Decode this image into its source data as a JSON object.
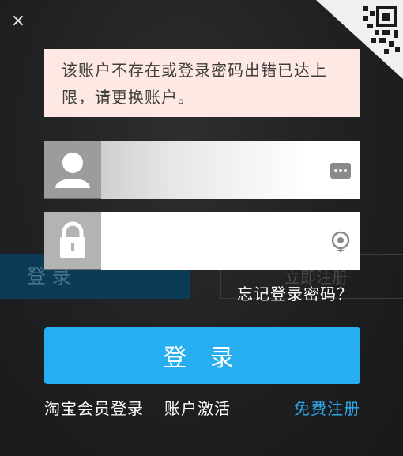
{
  "window": {
    "close_glyph": "×"
  },
  "error": {
    "message": "该账户不存在或登录密码出错已达上限，请更换账户。"
  },
  "username_field": {
    "value": "",
    "icon": "user-icon",
    "right_icon": "dots-keyboard-icon"
  },
  "password_field": {
    "value": "",
    "icon": "lock-icon",
    "right_icon": "eye-toggle-icon"
  },
  "background": {
    "ghost_login_label": "登 录",
    "ghost_register_label": "立即注册"
  },
  "forgot_password_label": "忘记登录密码？",
  "login_button_label": "登 录",
  "links": {
    "taobao_login": "淘宝会员登录",
    "activate_account": "账户激活",
    "free_register": "免费注册"
  },
  "colors": {
    "accent": "#27aef0",
    "error_bg": "#fde8e3",
    "register_link": "#2ea7e8"
  }
}
